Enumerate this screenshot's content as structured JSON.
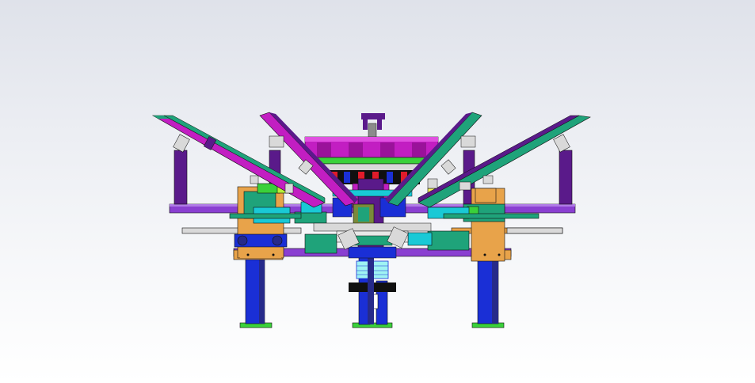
{
  "viewport": {
    "background_top": "#dfe2ea",
    "background_bottom": "#ffffff"
  },
  "model": {
    "colors": {
      "magenta": "#c21ec2",
      "dark_violet": "#5a1a8a",
      "purple": "#8a3fd1",
      "teal_green": "#1fa37a",
      "cyan": "#19c9d6",
      "orange": "#e8a34a",
      "blue": "#1a2fd6",
      "green": "#3ad13a",
      "lime": "#b6f03a",
      "red": "#e01b2a",
      "black": "#101010",
      "gray": "#8b8b8b",
      "light_gray": "#d9d9d9",
      "yellow": "#f0f05a",
      "navy": "#262a8a",
      "light_cyan": "#9ff3f3",
      "olive": "#7a8a3a"
    }
  }
}
